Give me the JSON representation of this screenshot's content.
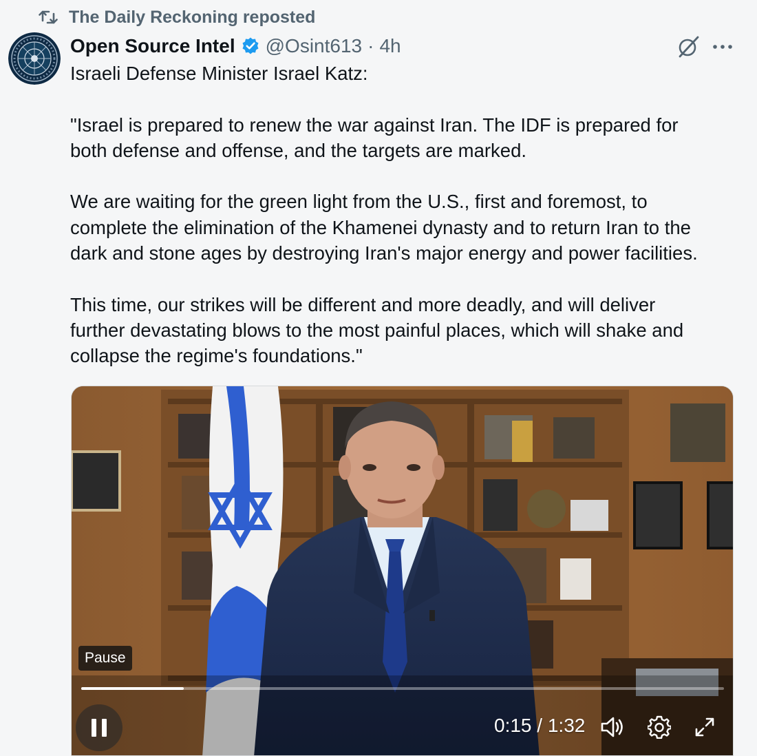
{
  "repost": {
    "icon": "repost-icon",
    "text": "The Daily Reckoning reposted"
  },
  "author": {
    "avatar_icon": "osint-logo-avatar",
    "name": "Open Source Intel",
    "verified_icon": "verified-badge-icon",
    "handle": "@Osint613",
    "separator": "·",
    "time": "4h"
  },
  "actions": {
    "grok_icon": "grok-icon",
    "more_icon": "more-horizontal-icon"
  },
  "tweet": {
    "lines": [
      "Israeli Defense Minister Israel Katz:",
      "",
      "\"Israel is prepared to renew the war against Iran. The IDF is prepared for",
      "both defense and offense, and the targets are marked.",
      "",
      "We are waiting for the green light from the U.S., first and foremost, to",
      "complete the elimination of the Khamenei dynasty and to return Iran to the",
      "dark and stone ages by destroying Iran's major energy and power facilities.",
      "",
      "This time, our strikes will be different and more deadly, and will deliver",
      "further devastating blows to the most painful places, which will shake and",
      "collapse the regime's foundations.\""
    ]
  },
  "video": {
    "tooltip": "Pause",
    "progress_fraction": 0.16,
    "current_time": "0:15",
    "time_separator": "/",
    "duration": "1:32",
    "pause_icon": "pause-icon",
    "volume_icon": "volume-icon",
    "settings_icon": "settings-gear-icon",
    "fullscreen_icon": "fullscreen-icon"
  },
  "colors": {
    "text": "#0f1419",
    "secondary": "#536471",
    "verified": "#1d9bf0",
    "flag_blue": "#2f5fd0",
    "suit": "#1f2d4f",
    "tie": "#1e3a8a"
  }
}
